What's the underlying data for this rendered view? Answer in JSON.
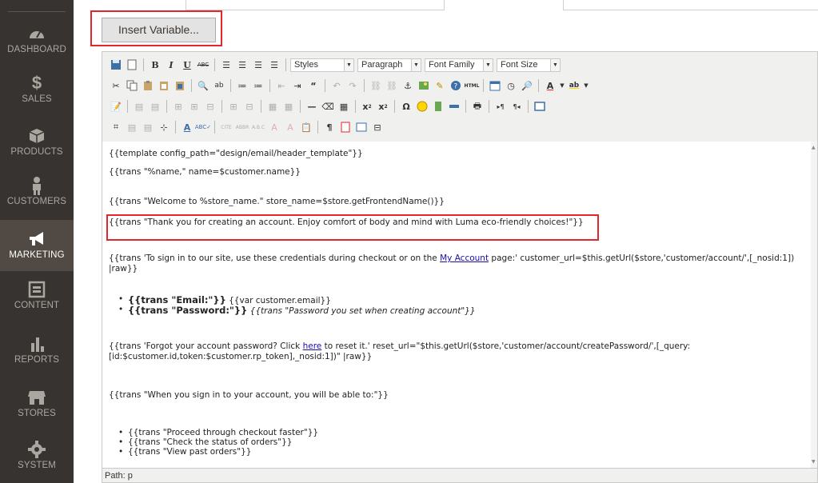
{
  "sidebar": {
    "items": [
      {
        "label": "DASHBOARD",
        "icon": "dashboard-icon"
      },
      {
        "label": "SALES",
        "icon": "dollar-icon"
      },
      {
        "label": "PRODUCTS",
        "icon": "cube-icon"
      },
      {
        "label": "CUSTOMERS",
        "icon": "person-icon"
      },
      {
        "label": "MARKETING",
        "icon": "megaphone-icon",
        "active": true
      },
      {
        "label": "CONTENT",
        "icon": "layout-icon"
      },
      {
        "label": "REPORTS",
        "icon": "bar-chart-icon"
      },
      {
        "label": "STORES",
        "icon": "store-icon"
      },
      {
        "label": "SYSTEM",
        "icon": "gear-icon"
      }
    ]
  },
  "insert_variable": {
    "label": "Insert Variable..."
  },
  "toolbar": {
    "styles": "Styles",
    "paragraph": "Paragraph",
    "font_family": "Font Family",
    "font_size": "Font Size"
  },
  "editor": {
    "line1": "{{template config_path=\"design/email/header_template\"}}",
    "line2": "{{trans \"%name,\" name=$customer.name}}",
    "line3": "{{trans \"Welcome to %store_name.\" store_name=$store.getFrontendName()}}",
    "line4": "{{trans \"Thank you for creating an account. Enjoy comfort of body and mind with Luma eco-friendly choices!\"}}",
    "line5_a": "{{trans 'To sign in to our site, use these credentials during checkout or on the ",
    "line5_link": "My Account",
    "line5_b": " page:' customer_url=$this.getUrl($store,'customer/account/',[_nosid:1]) |raw}}",
    "bullet1_bold": "{{trans \"Email:\"}}",
    "bullet1_rest": " {{var customer.email}}",
    "bullet2_bold": "{{trans \"Password:\"}}",
    "bullet2_rest": " {{trans \"Password you set when creating account\"}}",
    "line6_a": "{{trans 'Forgot your account password? Click ",
    "line6_link": "here",
    "line6_b": " to reset it.' reset_url=\"$this.getUrl($store,'customer/account/createPassword/',[_query:[id:$customer.id,token:$customer.rp_token],_nosid:1])\" |raw}}",
    "line7": "{{trans \"When you sign in to your account, you will be able to:\"}}",
    "list": [
      "{{trans \"Proceed through checkout faster\"}}",
      "{{trans \"Check the status of orders\"}}",
      "{{trans \"View past orders\"}}"
    ]
  },
  "status": {
    "path": "Path: p"
  },
  "colors": {
    "sidebar_bg": "#373330",
    "active_bg": "#514943",
    "highlight": "#e2262a",
    "link": "#1a0dab"
  }
}
